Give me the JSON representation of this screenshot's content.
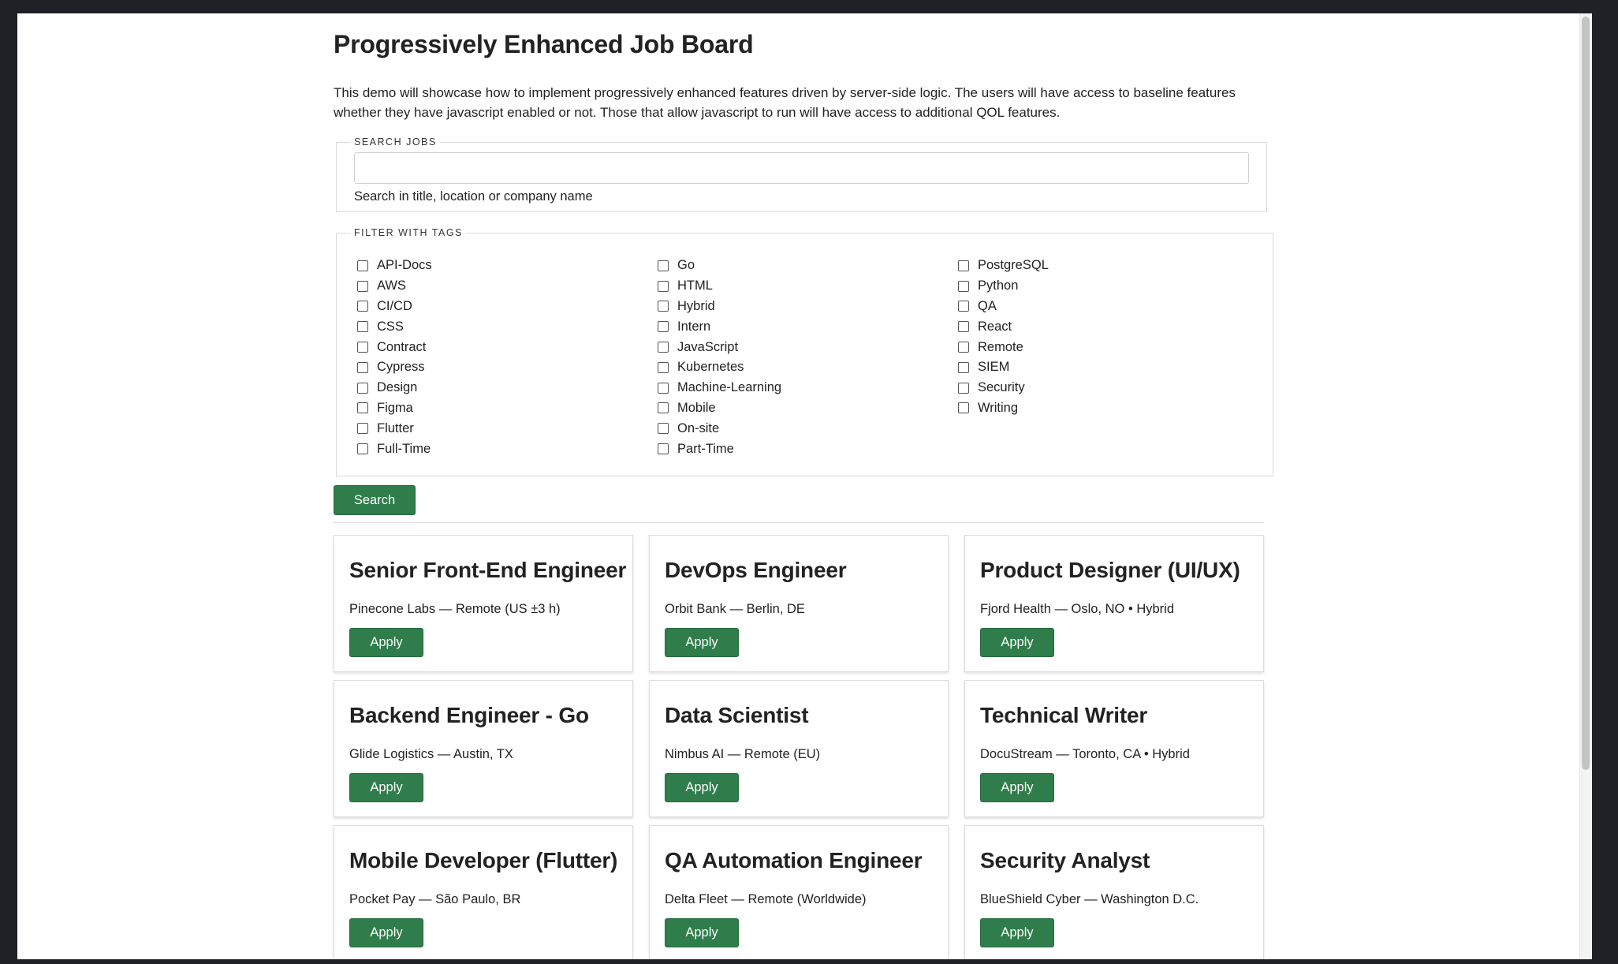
{
  "page": {
    "title": "Progressively Enhanced Job Board",
    "intro": "This demo will showcase how to implement progressively enhanced features driven by server-side logic. The users will have access to baseline features whether they have javascript enabled or not. Those that allow javascript to run will have access to additional QOL features."
  },
  "search": {
    "legend": "SEARCH JOBS",
    "value": "",
    "placeholder": "",
    "help": "Search in title, location or company name"
  },
  "filters": {
    "legend": "FILTER WITH TAGS",
    "tags": [
      "API-Docs",
      "AWS",
      "CI/CD",
      "CSS",
      "Contract",
      "Cypress",
      "Design",
      "Figma",
      "Flutter",
      "Full-Time",
      "Go",
      "HTML",
      "Hybrid",
      "Intern",
      "JavaScript",
      "Kubernetes",
      "Machine-Learning",
      "Mobile",
      "On-site",
      "Part-Time",
      "PostgreSQL",
      "Python",
      "QA",
      "React",
      "Remote",
      "SIEM",
      "Security",
      "Writing"
    ]
  },
  "search_button": "Search",
  "jobs": [
    {
      "title": "Senior Front-End Engineer",
      "meta": "Pinecone Labs — Remote (US ±3 h)",
      "apply": "Apply"
    },
    {
      "title": "DevOps Engineer",
      "meta": "Orbit Bank — Berlin, DE",
      "apply": "Apply"
    },
    {
      "title": "Product Designer (UI/UX)",
      "meta": "Fjord Health — Oslo, NO • Hybrid",
      "apply": "Apply"
    },
    {
      "title": "Backend Engineer - Go",
      "meta": "Glide Logistics — Austin, TX",
      "apply": "Apply"
    },
    {
      "title": "Data Scientist",
      "meta": "Nimbus AI — Remote (EU)",
      "apply": "Apply"
    },
    {
      "title": "Technical Writer",
      "meta": "DocuStream — Toronto, CA • Hybrid",
      "apply": "Apply"
    },
    {
      "title": "Mobile Developer (Flutter)",
      "meta": "Pocket Pay — São Paulo, BR",
      "apply": "Apply"
    },
    {
      "title": "QA Automation Engineer",
      "meta": "Delta Fleet — Remote (Worldwide)",
      "apply": "Apply"
    },
    {
      "title": "Security Analyst",
      "meta": "BlueShield Cyber — Washington D.C.",
      "apply": "Apply"
    }
  ],
  "colors": {
    "accent": "#2e7d4a",
    "frame": "#202127",
    "background": "#ffffff"
  }
}
